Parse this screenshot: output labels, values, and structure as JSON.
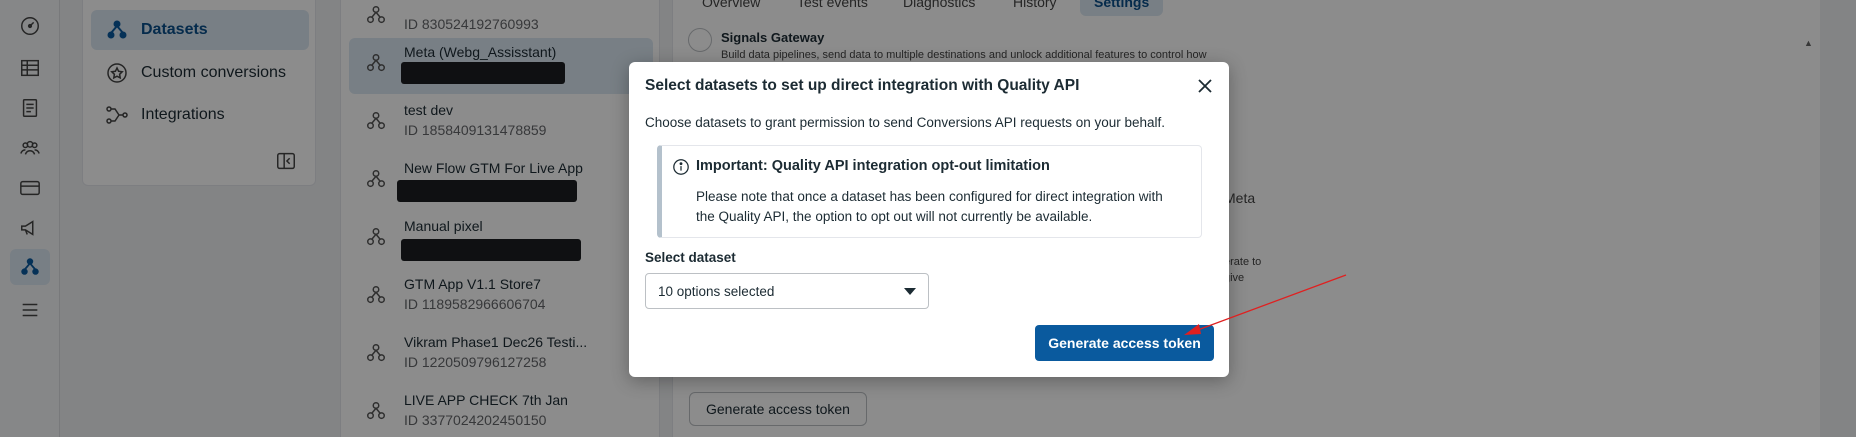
{
  "nav": {
    "side_items": [
      {
        "label": "Datasets",
        "icon": "datasets-icon"
      },
      {
        "label": "Custom conversions",
        "icon": "star-badge-icon"
      },
      {
        "label": "Integrations",
        "icon": "integrations-icon"
      }
    ]
  },
  "dataset_list": [
    {
      "name": "",
      "id": "ID 830524192760993"
    },
    {
      "name": "Meta (Webg_Assisstant)",
      "id": ""
    },
    {
      "name": "test dev",
      "id": "ID 1858409131478859"
    },
    {
      "name": "New Flow GTM For Live App",
      "id": ""
    },
    {
      "name": "Manual pixel",
      "id": ""
    },
    {
      "name": "GTM App V1.1 Store7",
      "id": "ID 1189582966606704"
    },
    {
      "name": "Vikram Phase1 Dec26 Testi...",
      "id": "ID 1220509796127258"
    },
    {
      "name": "LIVE APP CHECK 7th Jan",
      "id": "ID 3377024202450150"
    }
  ],
  "tabs": [
    {
      "label": "Overview"
    },
    {
      "label": "Test events"
    },
    {
      "label": "Diagnostics"
    },
    {
      "label": "History"
    },
    {
      "label": "Settings"
    }
  ],
  "settings": {
    "signals_title": "Signals Gateway",
    "signals_desc": "Build data pipelines, send data to multiple destinations and unlock additional features to control how",
    "frag_meta": "Meta",
    "frag_rate": "erate to",
    "frag_give": "give",
    "bg_button": "Generate access token"
  },
  "modal": {
    "title": "Select datasets to set up direct integration with Quality API",
    "subtitle": "Choose datasets to grant permission to send Conversions API requests on your behalf.",
    "notice_title": "Important: Quality API integration opt-out limitation",
    "notice_body": "Please note that once a dataset has been configured for direct integration with the Quality API, the option to opt out will not currently be available.",
    "select_label": "Select dataset",
    "select_value": "10 options selected",
    "primary_button": "Generate access token"
  },
  "colors": {
    "accent": "#0a5a9e",
    "active_bg": "#dbe7f2",
    "annotation_arrow": "#e02020"
  }
}
